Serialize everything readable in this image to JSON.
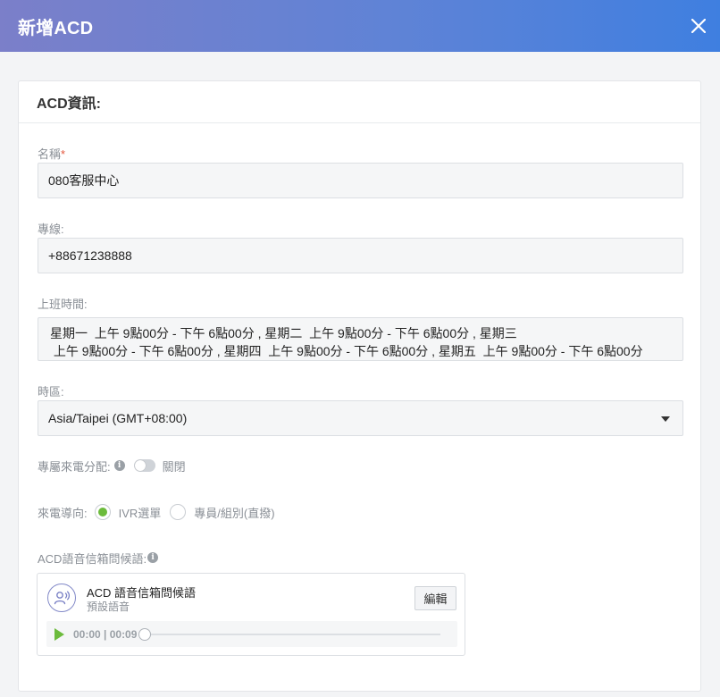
{
  "dialog": {
    "title": "新增ACD"
  },
  "section": {
    "title": "ACD資訊:"
  },
  "fields": {
    "name": {
      "label": "名稱",
      "required_mark": "*",
      "value": "080客服中心"
    },
    "line": {
      "label": "專線:",
      "value": "+88671238888"
    },
    "hours": {
      "label": "上班時間:",
      "line1": "星期一  上午 9點00分 - 下午 6點00分 , 星期二  上午 9點00分 - 下午 6點00分 , 星期三",
      "line2": " 上午 9點00分 - 下午 6點00分 , 星期四  上午 9點00分 - 下午 6點00分 , 星期五  上午 9點00分 - 下午 6點00分"
    },
    "timezone": {
      "label": "時區:",
      "value": "Asia/Taipei (GMT+08:00)"
    },
    "dedicated": {
      "label": "專屬來電分配:",
      "toggle_state": "關閉",
      "enabled": false
    },
    "routing": {
      "label": "來電導向:",
      "options": [
        "IVR選單",
        "專員/組別(直撥)"
      ],
      "selected": "IVR選單"
    },
    "greeting": {
      "label": "ACD語音信箱問候語:"
    }
  },
  "audio": {
    "title": "ACD 語音信箱問候語",
    "subtitle": "預設語音",
    "edit_label": "編輯",
    "time": "00:00 | 00:09",
    "progress": 0
  },
  "colors": {
    "header_gradient": [
      "#7b7fc9",
      "#3f7fe0"
    ],
    "accent_green": "#6cbb3c",
    "required_red": "#e4573d"
  },
  "icons": {
    "close": "close-icon",
    "info": "info-icon",
    "caret": "caret-down-icon",
    "voice": "voice-user-icon",
    "play": "play-icon"
  }
}
